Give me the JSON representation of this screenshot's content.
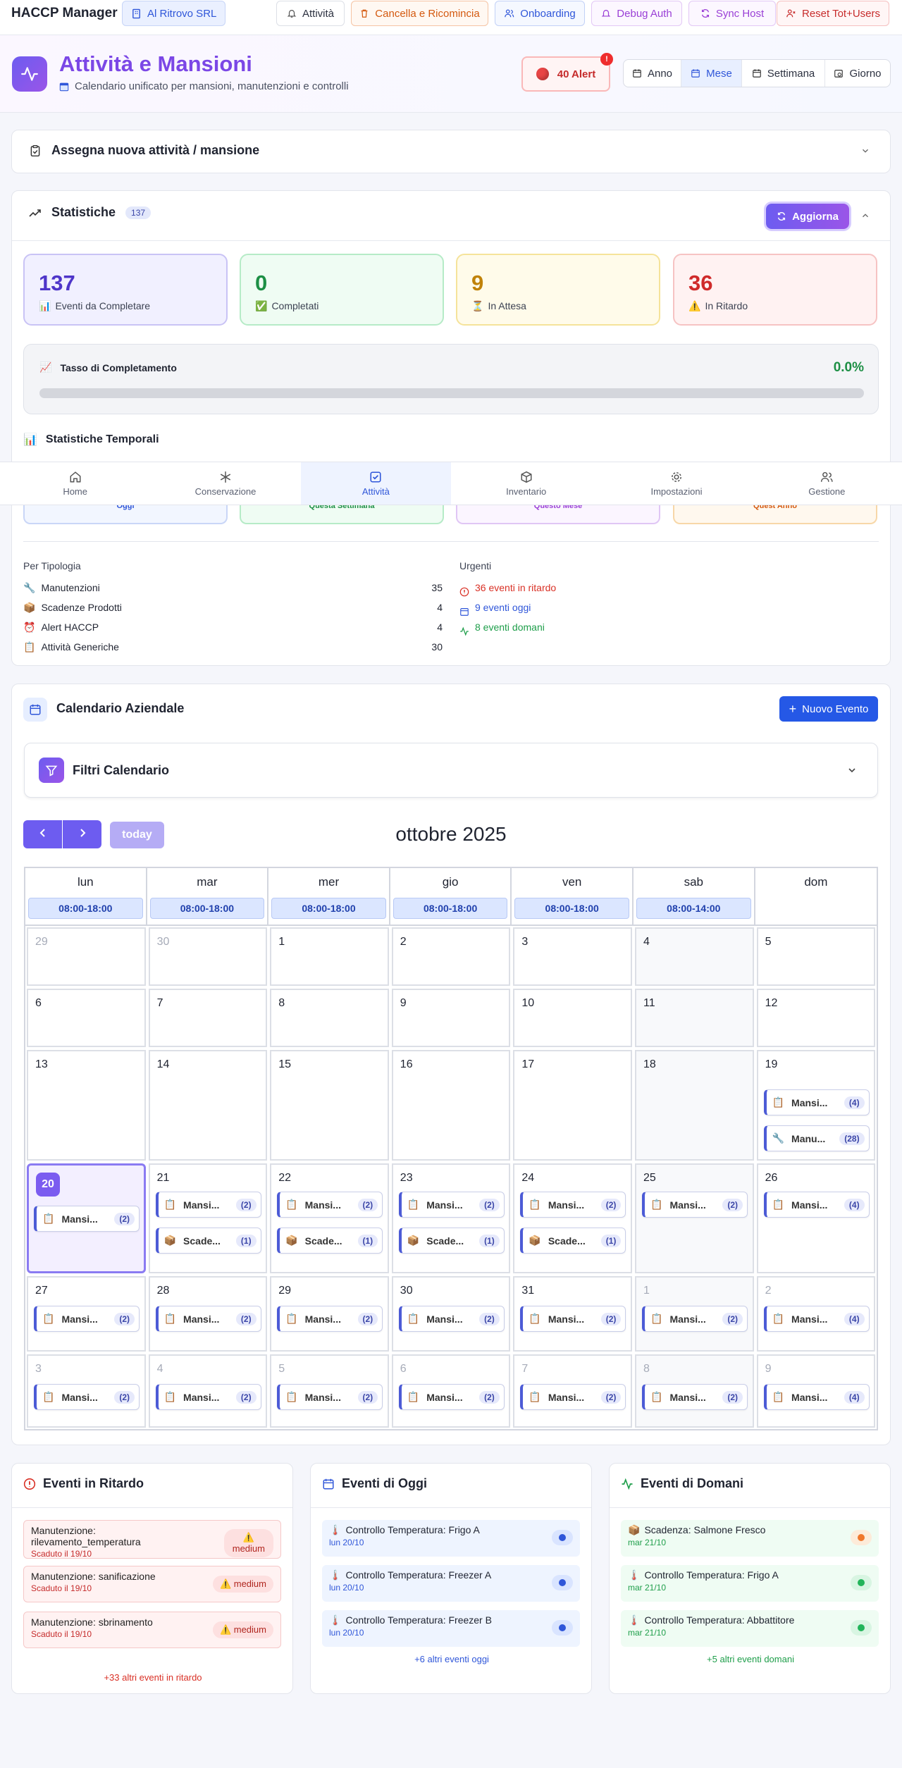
{
  "topbar": {
    "brand": "HACCP Manager",
    "company": "Al Ritrovo SRL",
    "buttons": [
      {
        "label": "Attività"
      },
      {
        "label": "Cancella e Ricomincia"
      },
      {
        "label": "Onboarding"
      },
      {
        "label": "Debug Auth"
      },
      {
        "label": "Sync Host"
      },
      {
        "label": "Reset Tot+Users"
      }
    ]
  },
  "header": {
    "title": "Attività e Mansioni",
    "subtitle": "Calendario unificato per mansioni, manutenzioni e controlli",
    "alert_label": "40 Alert",
    "alert_badge": "!",
    "views": [
      "Anno",
      "Mese",
      "Settimana",
      "Giorno"
    ],
    "active_view": "Mese"
  },
  "assign": {
    "title": "Assegna nuova attività / mansione"
  },
  "stats": {
    "title": "Statistiche",
    "count_badge": "137",
    "refresh_label": "Aggiorna",
    "cards": [
      {
        "value": "137",
        "label": "Eventi da Completare"
      },
      {
        "value": "0",
        "label": "Completati"
      },
      {
        "value": "9",
        "label": "In Attesa"
      },
      {
        "value": "36",
        "label": "In Ritardo"
      }
    ],
    "completion": {
      "label": "Tasso di Completamento",
      "value": "0.0%",
      "fraction": 0.0
    },
    "temporal_title": "Statistiche Temporali",
    "temporal_tabs": [
      "Oggi",
      "Questa Settimana",
      "Questo Mese",
      "Quest'Anno"
    ],
    "by_type_title": "Per Tipologia",
    "by_type": [
      {
        "label": "Manutenzioni",
        "value": "35"
      },
      {
        "label": "Scadenze Prodotti",
        "value": "4"
      },
      {
        "label": "Alert HACCP",
        "value": "4"
      },
      {
        "label": "Attività Generiche",
        "value": "30"
      }
    ],
    "urgent_title": "Urgenti",
    "urgent": [
      {
        "label": "36 eventi in ritardo",
        "color": "#d93025"
      },
      {
        "label": "9 eventi oggi",
        "color": "#2f56d9"
      },
      {
        "label": "8 eventi domani",
        "color": "#1e9e4a"
      }
    ]
  },
  "nav": {
    "items": [
      "Home",
      "Conservazione",
      "Attività",
      "Inventario",
      "Impostazioni",
      "Gestione"
    ],
    "active": "Attività"
  },
  "calendar": {
    "title": "Calendario Aziendale",
    "new_event_label": "Nuovo Evento",
    "filters_title": "Filtri Calendario",
    "today_label": "today",
    "month_title": "ottobre 2025",
    "columns": [
      {
        "name": "lun",
        "hours": "08:00-18:00"
      },
      {
        "name": "mar",
        "hours": "08:00-18:00"
      },
      {
        "name": "mer",
        "hours": "08:00-18:00"
      },
      {
        "name": "gio",
        "hours": "08:00-18:00"
      },
      {
        "name": "ven",
        "hours": "08:00-18:00"
      },
      {
        "name": "sab",
        "hours": "08:00-14:00"
      },
      {
        "name": "dom",
        "hours": ""
      }
    ],
    "weeks": [
      [
        "29",
        "30",
        "1",
        "2",
        "3",
        "4",
        "5"
      ],
      [
        "6",
        "7",
        "8",
        "9",
        "10",
        "11",
        "12"
      ],
      [
        "13",
        "14",
        "15",
        "16",
        "17",
        "18",
        "19"
      ],
      [
        "20",
        "21",
        "22",
        "23",
        "24",
        "25",
        "26"
      ],
      [
        "27",
        "28",
        "29",
        "30",
        "31",
        "1",
        "2"
      ],
      [
        "3",
        "4",
        "5",
        "6",
        "7",
        "8",
        "9"
      ]
    ],
    "events": {
      "mansione": "Mansi...",
      "manutenzione": "Manu...",
      "scadenza": "Scade...",
      "c2": "(2)",
      "c4": "(4)",
      "c28": "(28)",
      "c1": "(1)"
    }
  },
  "late": {
    "title": "Eventi in Ritardo",
    "items": [
      {
        "title": "Manutenzione: rilevamento_temperatura",
        "sub": "Scaduto il 19/10",
        "badge": "medium"
      },
      {
        "title": "Manutenzione: sanificazione",
        "sub": "Scaduto il 19/10",
        "badge": "medium"
      },
      {
        "title": "Manutenzione: sbrinamento",
        "sub": "Scaduto il 19/10",
        "badge": "medium"
      }
    ],
    "more": "+33 altri eventi in ritardo"
  },
  "today_events": {
    "title": "Eventi di Oggi",
    "items": [
      {
        "title": "Controllo Temperatura: Frigo A",
        "sub": "lun 20/10"
      },
      {
        "title": "Controllo Temperatura: Freezer A",
        "sub": "lun 20/10"
      },
      {
        "title": "Controllo Temperatura: Freezer B",
        "sub": "lun 20/10"
      }
    ],
    "more": "+6 altri eventi oggi"
  },
  "tomorrow": {
    "title": "Eventi di Domani",
    "items": [
      {
        "title": "Scadenza: Salmone Fresco",
        "sub": "mar 21/10"
      },
      {
        "title": "Controllo Temperatura: Frigo A",
        "sub": "mar 21/10"
      },
      {
        "title": "Controllo Temperatura: Abbattitore",
        "sub": "mar 21/10"
      }
    ],
    "more": "+5 altri eventi domani"
  }
}
